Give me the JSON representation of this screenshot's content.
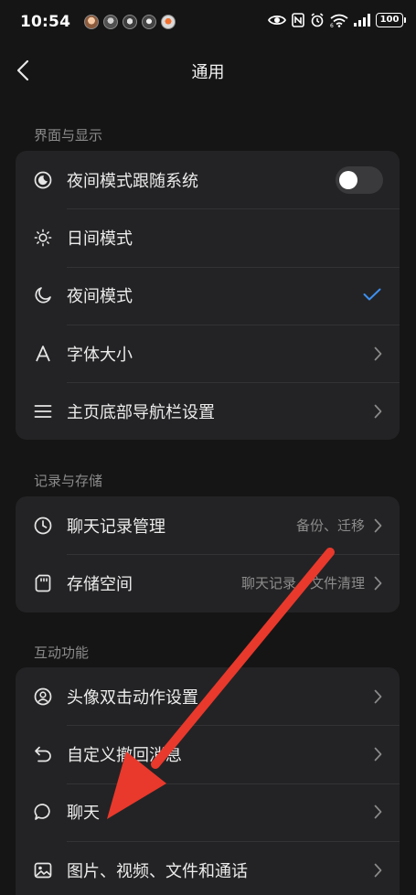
{
  "status_bar": {
    "time": "10:54",
    "battery": "100"
  },
  "header": {
    "title": "通用"
  },
  "sections": [
    {
      "title": "界面与显示",
      "items": [
        {
          "label": "夜间模式跟随系统",
          "icon": "moon-circle-icon",
          "control": "toggle",
          "toggle_on": false
        },
        {
          "label": "日间模式",
          "icon": "sun-icon"
        },
        {
          "label": "夜间模式",
          "icon": "moon-icon",
          "control": "check",
          "selected": true
        },
        {
          "label": "字体大小",
          "icon": "font-icon",
          "control": "chevron"
        },
        {
          "label": "主页底部导航栏设置",
          "icon": "menu-icon",
          "control": "chevron"
        }
      ]
    },
    {
      "title": "记录与存储",
      "items": [
        {
          "label": "聊天记录管理",
          "value": "备份、迁移",
          "icon": "clock-icon",
          "control": "chevron"
        },
        {
          "label": "存储空间",
          "value": "聊天记录、文件清理",
          "icon": "sd-card-icon",
          "control": "chevron"
        }
      ]
    },
    {
      "title": "互动功能",
      "items": [
        {
          "label": "头像双击动作设置",
          "icon": "avatar-icon",
          "control": "chevron"
        },
        {
          "label": "自定义撤回消息",
          "icon": "undo-icon",
          "control": "chevron"
        },
        {
          "label": "聊天",
          "icon": "chat-bubble-icon",
          "control": "chevron"
        },
        {
          "label": "图片、视频、文件和通话",
          "icon": "image-icon",
          "control": "chevron"
        }
      ]
    }
  ],
  "colors": {
    "background": "#151515",
    "card": "#232325",
    "accent": "#3d8fef",
    "annotation_arrow": "#e8392c"
  }
}
